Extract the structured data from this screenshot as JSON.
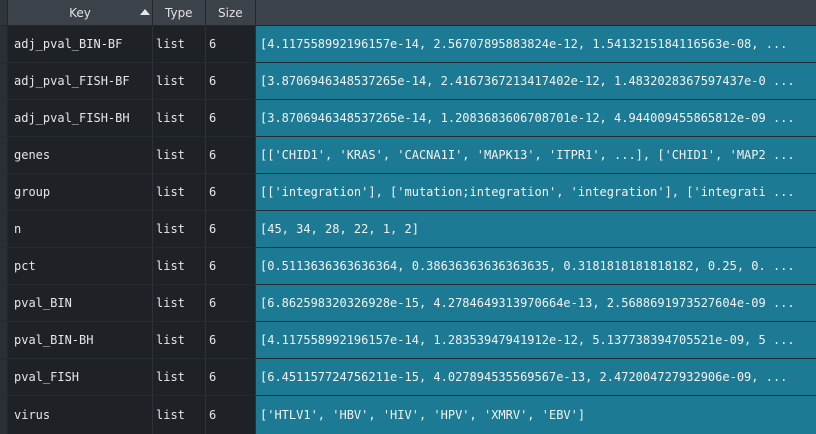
{
  "columns": {
    "key": "Key",
    "type": "Type",
    "size": "Size"
  },
  "rows": [
    {
      "key": "adj_pval_BIN-BF",
      "type": "list",
      "size": "6",
      "value": "[4.117558992196157e-14, 2.56707895883824e-12, 1.5413215184116563e-08, ..."
    },
    {
      "key": "adj_pval_FISH-BF",
      "type": "list",
      "size": "6",
      "value": "[3.8706946348537265e-14, 2.4167367213417402e-12, 1.4832028367597437e-0 ..."
    },
    {
      "key": "adj_pval_FISH-BH",
      "type": "list",
      "size": "6",
      "value": "[3.8706946348537265e-14, 1.2083683606708701e-12, 4.944009455865812e-09 ..."
    },
    {
      "key": "genes",
      "type": "list",
      "size": "6",
      "value": "[['CHID1', 'KRAS', 'CACNA1I', 'MAPK13', 'ITPR1', ...], ['CHID1', 'MAP2 ..."
    },
    {
      "key": "group",
      "type": "list",
      "size": "6",
      "value": "[['integration'], ['mutation;integration', 'integration'], ['integrati ..."
    },
    {
      "key": "n",
      "type": "list",
      "size": "6",
      "value": "[45, 34, 28, 22, 1, 2]"
    },
    {
      "key": "pct",
      "type": "list",
      "size": "6",
      "value": "[0.5113636363636364, 0.38636363636363635, 0.3181818181818182, 0.25, 0. ..."
    },
    {
      "key": "pval_BIN",
      "type": "list",
      "size": "6",
      "value": "[6.862598320326928e-15, 4.2784649313970664e-13, 2.5688691973527604e-09 ..."
    },
    {
      "key": "pval_BIN-BH",
      "type": "list",
      "size": "6",
      "value": "[4.117558992196157e-14, 1.28353947941912e-12, 5.137738394705521e-09, 5 ..."
    },
    {
      "key": "pval_FISH",
      "type": "list",
      "size": "6",
      "value": "[6.451157724756211e-15, 4.027894535569567e-13, 2.472004727932906e-09, ..."
    },
    {
      "key": "virus",
      "type": "list",
      "size": "6",
      "value": "['HTLV1', 'HBV', 'HIV', 'HPV', 'XMRV', 'EBV']"
    }
  ]
}
